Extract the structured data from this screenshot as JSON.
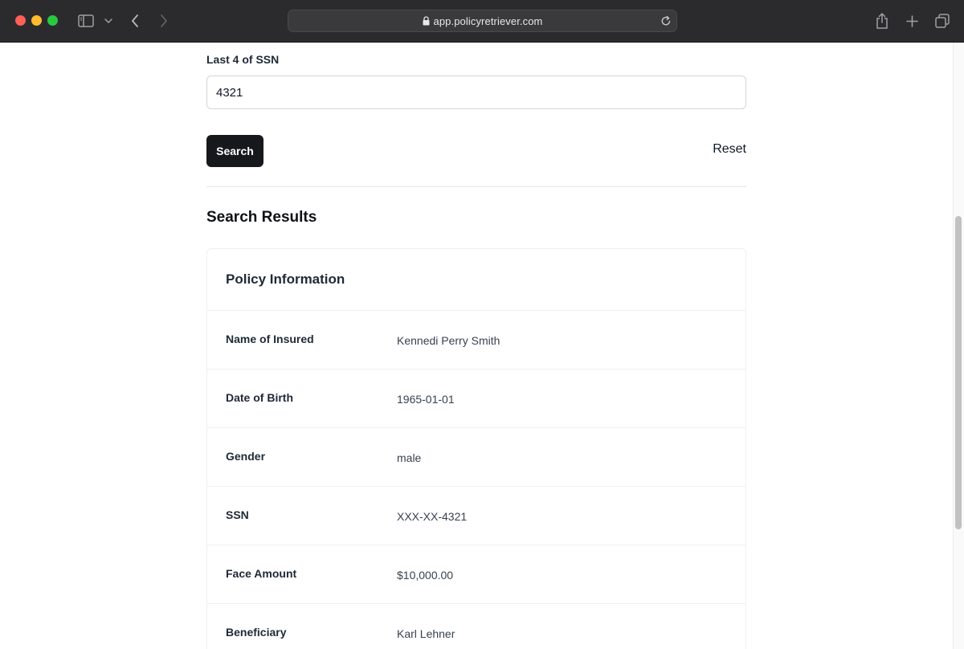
{
  "browser": {
    "url": "app.policyretriever.com"
  },
  "form": {
    "ssn_label": "Last 4 of SSN",
    "ssn_value": "4321",
    "search_label": "Search",
    "reset_label": "Reset"
  },
  "results": {
    "title": "Search Results",
    "card_title": "Policy Information",
    "rows": [
      {
        "label": "Name of Insured",
        "value": "Kennedi Perry Smith"
      },
      {
        "label": "Date of Birth",
        "value": "1965-01-01"
      },
      {
        "label": "Gender",
        "value": "male"
      },
      {
        "label": "SSN",
        "value": "XXX-XX-4321"
      },
      {
        "label": "Face Amount",
        "value": "$10,000.00"
      },
      {
        "label": "Beneficiary",
        "value": "Karl Lehner"
      }
    ]
  },
  "icons": [
    "sidebar-icon",
    "chevron-down-icon",
    "back-icon",
    "forward-icon",
    "lock-icon",
    "reload-icon",
    "share-icon",
    "new-tab-icon",
    "tabs-overview-icon"
  ]
}
